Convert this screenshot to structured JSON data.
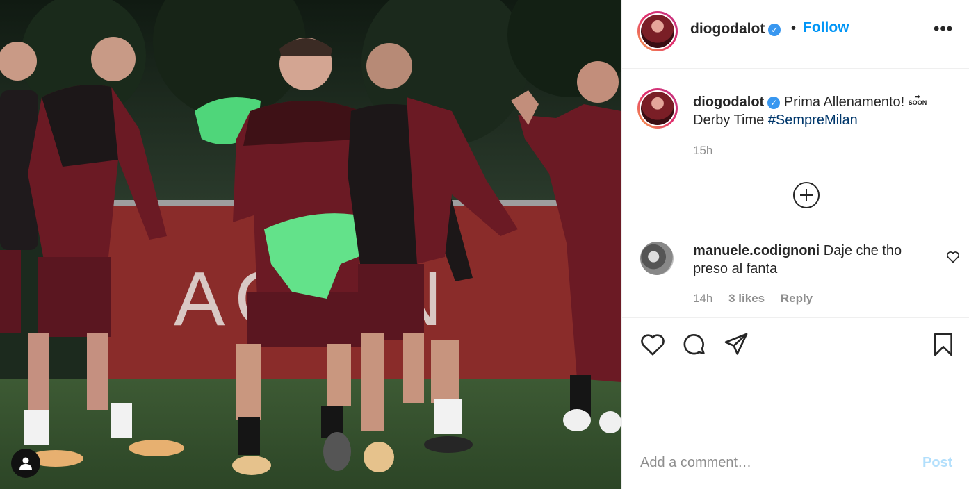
{
  "post": {
    "photo_alt": "AC Milan training photo",
    "photo_board_text": "AC    AN"
  },
  "header": {
    "username": "diogodalot",
    "verified_icon": "verified-badge-icon",
    "separator": "•",
    "follow_label": "Follow",
    "more_label": "•••"
  },
  "caption": {
    "username": "diogodalot",
    "text_part1": " Prima Allenamento! ",
    "soon_emoji_top": "➡",
    "soon_emoji_bottom": "SOON",
    "text_part2": " Derby Time ",
    "hashtag": "#SempreMilan",
    "time": "15h"
  },
  "comment": {
    "username": "manuele.codignoni",
    "text": " Daje che tho preso al fanta",
    "time": "14h",
    "likes": "3 likes",
    "reply_label": "Reply"
  },
  "add_comment": {
    "placeholder": "Add a comment…",
    "post_label": "Post"
  },
  "colors": {
    "follow": "#0095f6",
    "post_disabled": "#b2dffc",
    "hashtag": "#00376b",
    "kit_maroon": "#6b1a24"
  }
}
